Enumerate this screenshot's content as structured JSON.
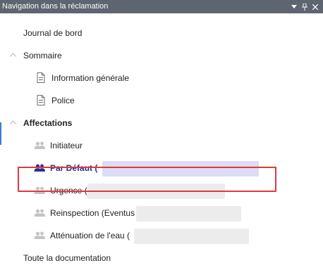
{
  "titlebar": {
    "title": "Navigation dans la réclamation",
    "dropdown_icon": "chevron-down-icon",
    "pin_icon": "pin-icon",
    "close_icon": "close-icon"
  },
  "tree": {
    "journal": "Journal de bord",
    "sommaire": "Sommaire",
    "info_generale": "Information générale",
    "police": "Police",
    "affectations": "Affectations",
    "initiateur": "Initiateur",
    "par_defaut": "Par Défaut (",
    "urgence": "Urgence (",
    "reinspection": "Reinspection (Eventus (",
    "attenuation": "Atténuation de l'eau (",
    "documentation": "Toute la documentation"
  },
  "colors": {
    "titlebar_bg": "#5d6570",
    "accent": "#3b7bd8",
    "selected_text": "#2b2f8f",
    "highlight_border": "#e0393b",
    "redaction_selected": "#dcdcf4",
    "redaction": "#ececec"
  }
}
